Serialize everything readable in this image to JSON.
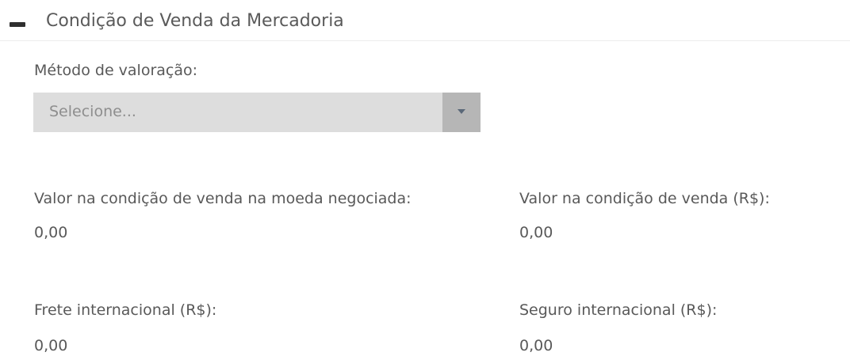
{
  "section": {
    "title": "Condição de Venda da Mercadoria",
    "collapse_icon": "minus-icon"
  },
  "valuation_method": {
    "label": "Método de valoração:",
    "placeholder": "Selecione...",
    "arrow_icon": "chevron-down-icon"
  },
  "fields": {
    "sale_value_currency": {
      "label": "Valor na condição de venda na moeda negociada:",
      "value": "0,00"
    },
    "sale_value_brl": {
      "label": "Valor na condição de venda (R$):",
      "value": "0,00"
    },
    "freight": {
      "label": "Frete internacional (R$):",
      "value": "0,00"
    },
    "insurance": {
      "label": "Seguro internacional (R$):",
      "value": "0,00"
    }
  }
}
